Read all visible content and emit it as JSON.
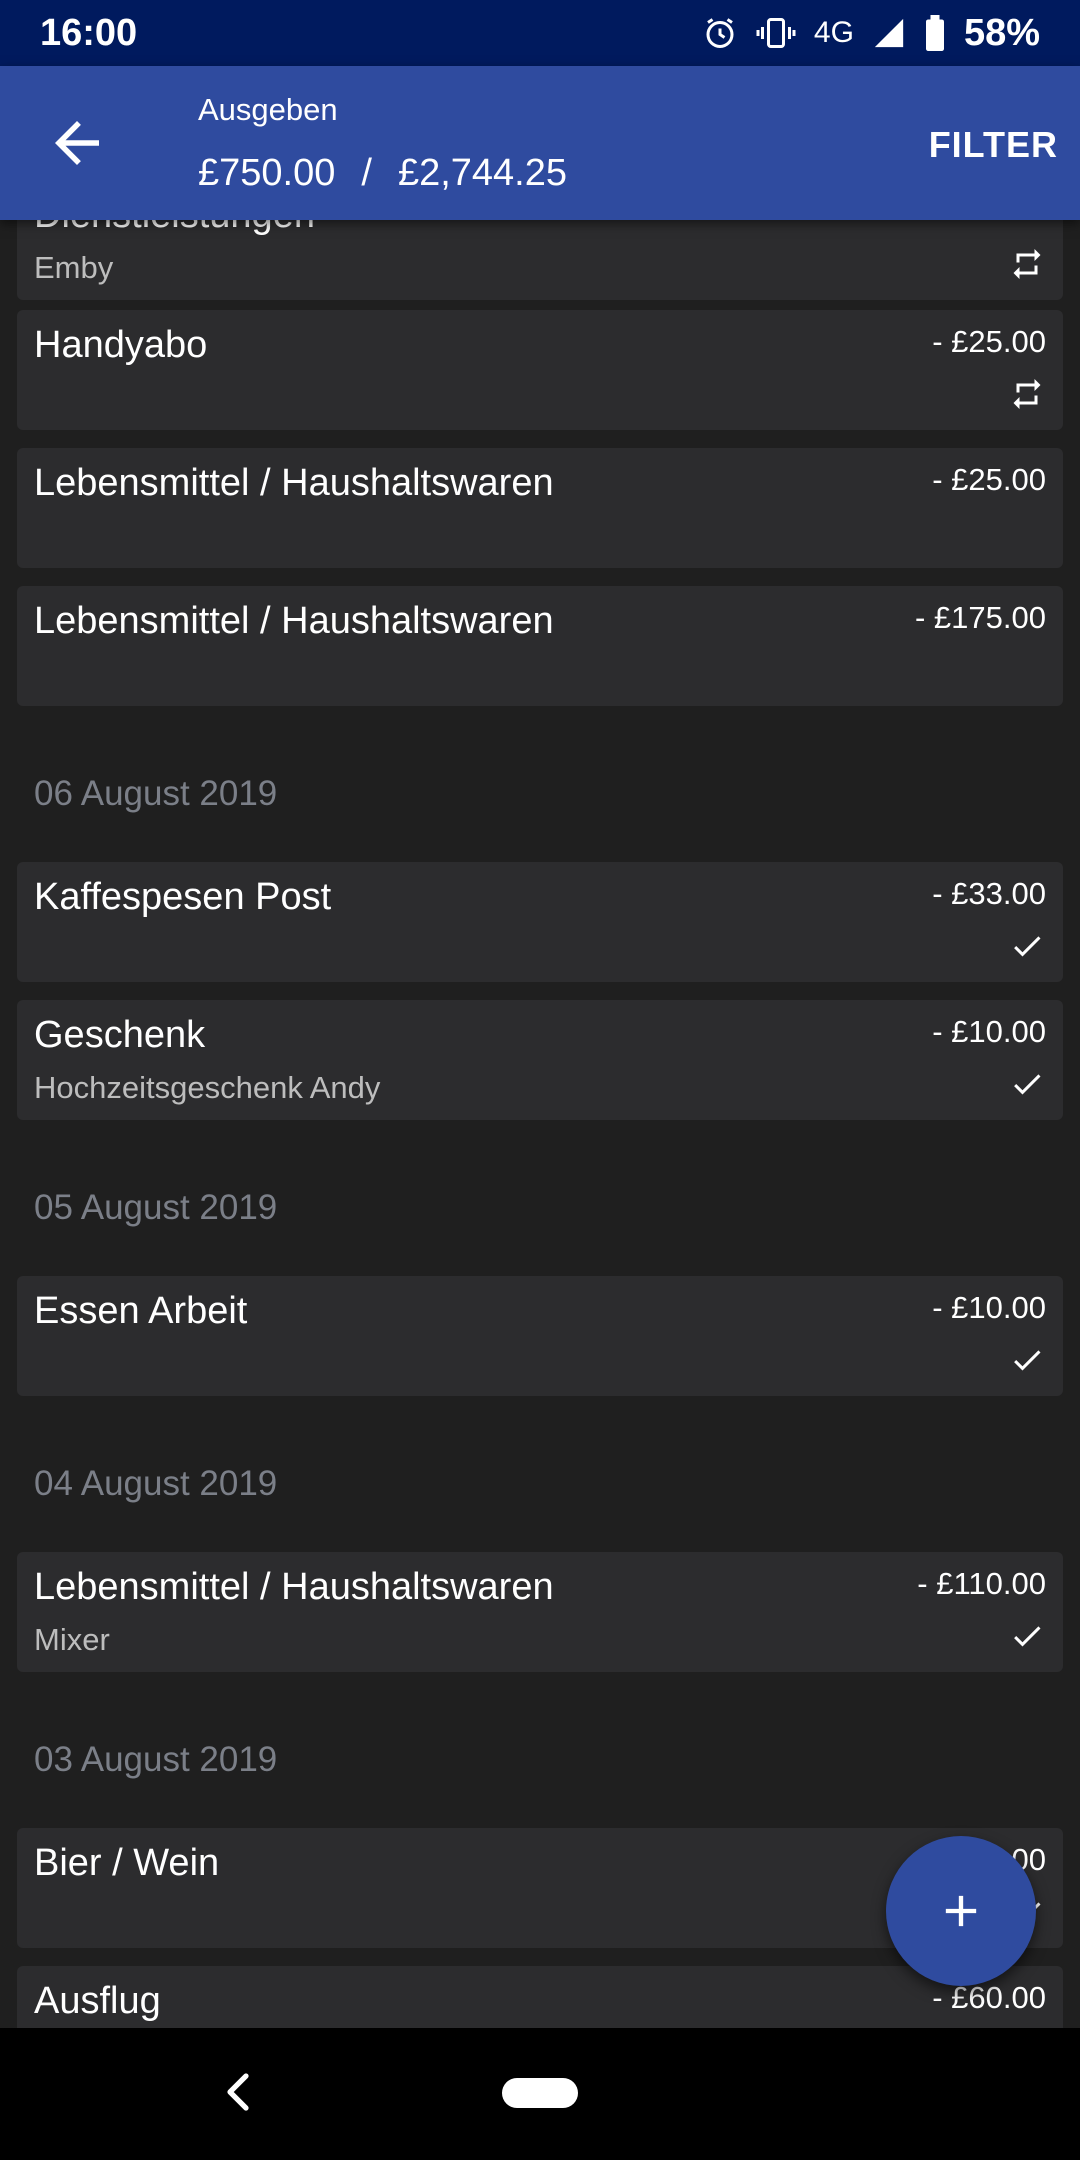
{
  "status_bar": {
    "time": "16:00",
    "network": "4G",
    "battery": "58%",
    "icons": [
      "alarm-icon",
      "vibrate-icon",
      "signal-icon",
      "battery-icon"
    ]
  },
  "app_bar": {
    "title": "Ausgeben",
    "spent": "£750.00",
    "separator": "/",
    "budget": "£2,744.25",
    "filter_label": "FILTER"
  },
  "list": {
    "items": [
      {
        "title": "Dienstleistungen",
        "subtitle": "Emby",
        "amount": "",
        "icon": "repeat"
      },
      {
        "title": "Handyabo",
        "subtitle": "",
        "amount": "- £25.00",
        "icon": "repeat"
      },
      {
        "title": "Lebensmittel / Haushaltswaren",
        "subtitle": "",
        "amount": "- £25.00",
        "icon": ""
      },
      {
        "title": "Lebensmittel / Haushaltswaren",
        "subtitle": "",
        "amount": "- £175.00",
        "icon": ""
      },
      {
        "date": "06 August 2019"
      },
      {
        "title": "Kaffespesen Post",
        "subtitle": "",
        "amount": "- £33.00",
        "icon": "check"
      },
      {
        "title": "Geschenk",
        "subtitle": "Hochzeitsgeschenk Andy",
        "amount": "- £10.00",
        "icon": "check"
      },
      {
        "date": "05 August 2019"
      },
      {
        "title": "Essen Arbeit",
        "subtitle": "",
        "amount": "- £10.00",
        "icon": "check"
      },
      {
        "date": "04 August 2019"
      },
      {
        "title": "Lebensmittel / Haushaltswaren",
        "subtitle": "Mixer",
        "amount": "- £110.00",
        "icon": "check"
      },
      {
        "date": "03 August 2019"
      },
      {
        "title": "Bier / Wein",
        "subtitle": "",
        "amount": "- £...00",
        "icon": "check"
      },
      {
        "title": "Ausflug",
        "subtitle": "",
        "amount": "- £60.00",
        "icon": ""
      }
    ]
  },
  "colors": {
    "app_bar": "#2f4b9f",
    "status_bar": "#001a5e",
    "card": "#2c2c2e",
    "background": "#1f1f1f",
    "date_text": "#7b7f88"
  }
}
